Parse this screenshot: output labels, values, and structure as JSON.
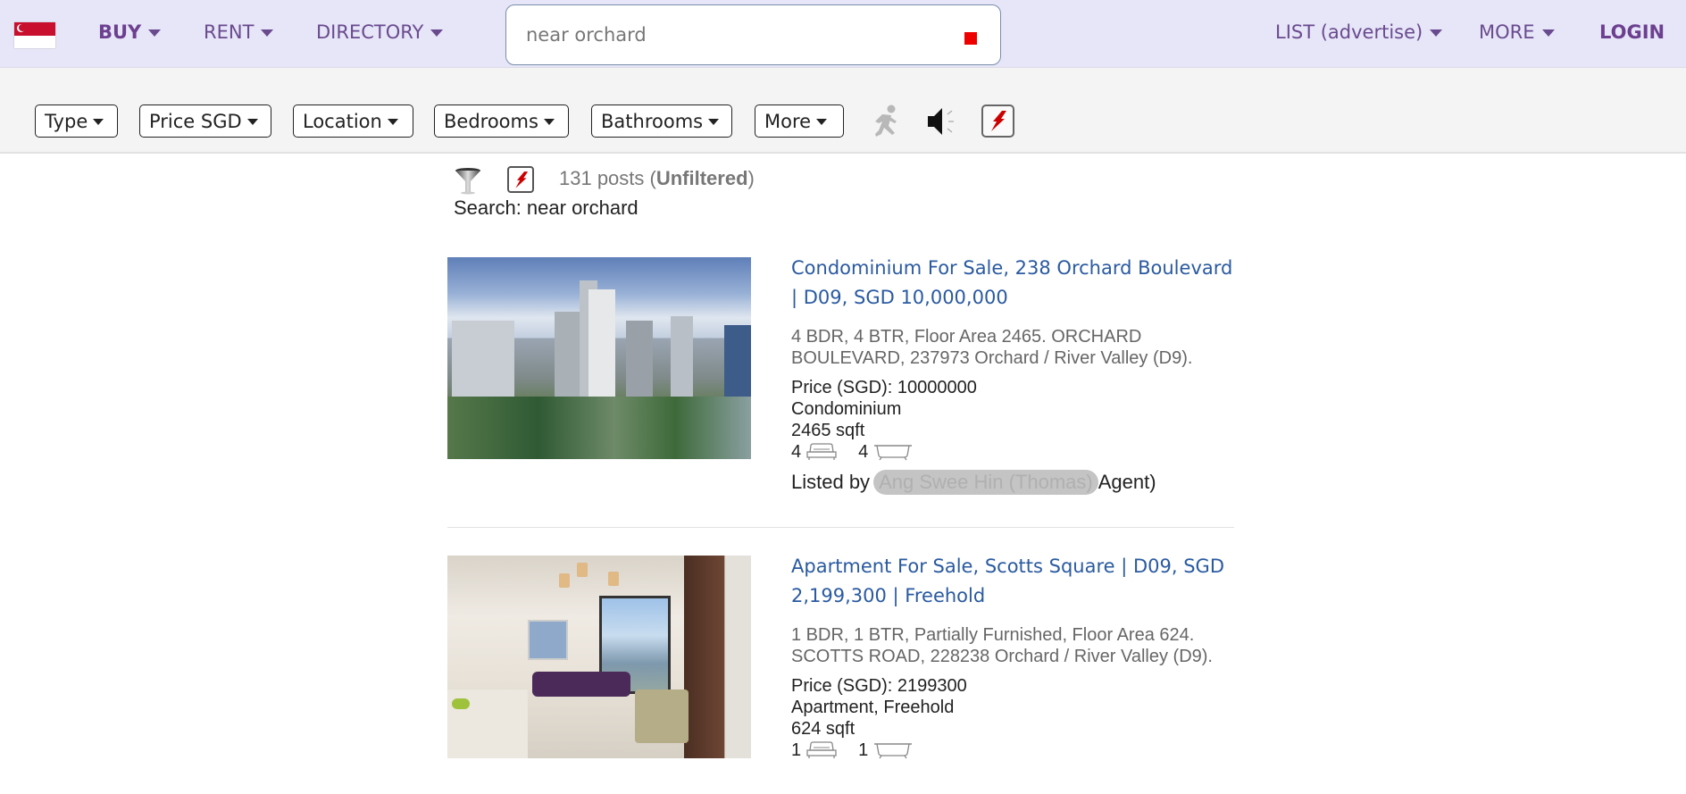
{
  "topnav": {
    "flag": "singapore-flag",
    "items_left": [
      {
        "label": "BUY",
        "bold": true
      },
      {
        "label": "RENT",
        "bold": false
      },
      {
        "label": "DIRECTORY",
        "bold": false
      }
    ],
    "search": {
      "value": "near orchard",
      "placeholder": "near orchard"
    },
    "items_right": [
      {
        "label": "LIST (advertise)"
      },
      {
        "label": "MORE"
      }
    ],
    "login_label": "LOGIN"
  },
  "filters": {
    "buttons": [
      {
        "label": "Type"
      },
      {
        "label": "Price SGD"
      },
      {
        "label": "Location"
      },
      {
        "label": "Bedrooms"
      },
      {
        "label": "Bathrooms"
      },
      {
        "label": "More"
      }
    ],
    "icons": [
      "running-man-icon",
      "speaker-icon",
      "lightning-bolt-icon"
    ]
  },
  "summary": {
    "count_prefix": "131 posts (",
    "count_status": "Unfiltered",
    "count_suffix": ")",
    "search_label": "Search: near orchard"
  },
  "listings": [
    {
      "title": "Condominium For Sale, 238 Orchard Boulevard | D09, SGD 10,000,000",
      "description": "4 BDR, 4 BTR, Floor Area 2465. ORCHARD BOULEVARD, 237973 Orchard / River Valley (D9).",
      "price": "Price (SGD): 10000000",
      "type": "Condominium",
      "area": "2465 sqft",
      "bedrooms": "4",
      "bathrooms": "4",
      "listed_by_label": "Listed by",
      "agent_name": "Ang Swee Hin (Thomas)",
      "agent_role": "Agent)"
    },
    {
      "title": "Apartment For Sale, Scotts Square | D09, SGD 2,199,300 | Freehold",
      "description": "1 BDR, 1 BTR, Partially Furnished, Floor Area 624. SCOTTS ROAD, 228238 Orchard / River Valley (D9).",
      "price": "Price (SGD): 2199300",
      "type": "Apartment, Freehold",
      "area": "624 sqft",
      "bedrooms": "1",
      "bathrooms": "1"
    }
  ],
  "colors": {
    "nav_bg": "#e6e6f8",
    "nav_text": "#6a4a8e",
    "link": "#2a5aa0",
    "filter_bg": "#f4f4f4",
    "stop_red": "#ee0000",
    "bolt_red": "#cc0000"
  }
}
